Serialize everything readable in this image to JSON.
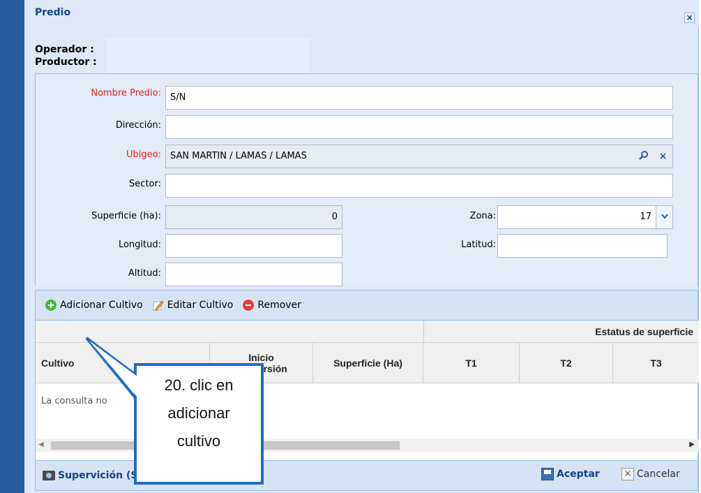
{
  "window": {
    "title": "Predio"
  },
  "header": {
    "operador_label": "Operador :",
    "productor_label": "Productor :"
  },
  "form": {
    "nombre_label": "Nombre Predio:",
    "nombre_value": "S/N",
    "direccion_label": "Dirección:",
    "direccion_value": "",
    "ubigeo_label": "Ubigeo:",
    "ubigeo_value": "SAN MARTIN / LAMAS / LAMAS",
    "sector_label": "Sector:",
    "sector_value": "",
    "superficie_label": "Superficie (ha):",
    "superficie_value": "0",
    "zona_label": "Zona:",
    "zona_value": "17",
    "longitud_label": "Longitud:",
    "longitud_value": "",
    "latitud_label": "Latitud:",
    "latitud_value": "",
    "altitud_label": "Altitud:",
    "altitud_value": ""
  },
  "toolbar": {
    "add_label": "Adicionar Cultivo",
    "edit_label": "Editar Cultivo",
    "remove_label": "Remover"
  },
  "grid": {
    "group_header": "Estatus de superficie",
    "columns": [
      "Cultivo",
      "Inicio\nconversión",
      "Superficie (Ha)",
      "T1",
      "T2",
      "T3"
    ],
    "col_inicio_line1": "Inicio",
    "col_inicio_line2": "conversión",
    "empty_message": "La consulta no"
  },
  "footer": {
    "supervision_label": "Supervición (SENASA)",
    "accept_label": "Aceptar",
    "cancel_label": "Cancelar"
  },
  "callout": {
    "line1": "20. clic en",
    "line2": "adicionar",
    "line3": "cultivo"
  },
  "colors": {
    "title": "#15428b",
    "required_label": "#e02020",
    "callout_border": "#1e6dc0",
    "window_bg": "#dfe8f6"
  },
  "icons": {
    "close": "close-icon",
    "search": "search-icon",
    "clear": "clear-icon",
    "dropdown": "chevron-down-icon",
    "add": "add-circle-icon",
    "edit": "pencil-icon",
    "remove": "remove-circle-icon",
    "camera": "camera-icon",
    "save": "save-icon",
    "cancel": "x-icon"
  }
}
